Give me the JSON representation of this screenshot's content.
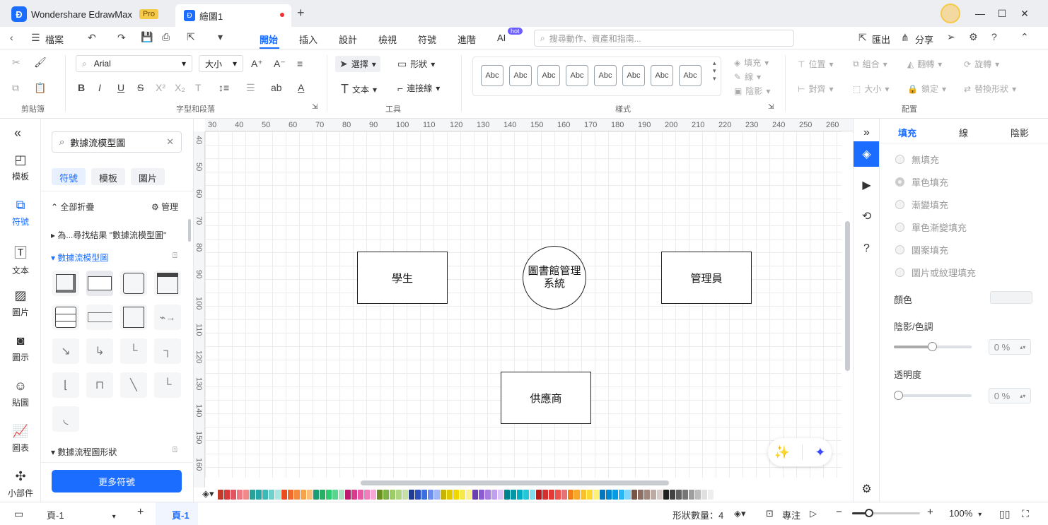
{
  "app": {
    "name": "Wondershare EdrawMax",
    "badge": "Pro",
    "doc_tab": "繪圖1"
  },
  "menu": {
    "back": "檔案",
    "items": [
      "開始",
      "插入",
      "設計",
      "檢視",
      "符號",
      "進階",
      "AI"
    ],
    "hot": "hot",
    "search_placeholder": "搜尋動作、資產和指南...",
    "export": "匯出",
    "share": "分享"
  },
  "ribbon": {
    "font": "Arial",
    "size": "大小",
    "select": "選擇",
    "shape": "形狀",
    "text": "文本",
    "connector": "連接線",
    "style_sample": "Abc",
    "fill": "填充",
    "line": "線",
    "shadow": "陰影",
    "position": "位置",
    "group": "組合",
    "flip": "翻轉",
    "rotate": "旋轉",
    "align": "對齊",
    "lock": "鎖定",
    "replace": "替換形狀",
    "groups": {
      "clipboard": "剪貼簿",
      "font_para": "字型和段落",
      "tools": "工具",
      "styles": "樣式",
      "arrange": "配置"
    }
  },
  "leftnav": [
    "模板",
    "符號",
    "文本",
    "圖片",
    "圖示",
    "貼圖",
    "圖表",
    "小部件"
  ],
  "library": {
    "search": "數據流模型圖",
    "chips": [
      "符號",
      "模板",
      "圖片"
    ],
    "collapse_all": "全部折疊",
    "manage": "管理",
    "result": "為...尋找結果 \"數據流模型圖\"",
    "section1": "數據流模型圖",
    "section2": "數據流程圖形狀",
    "more": "更多符號"
  },
  "rulers": {
    "h": [
      "30",
      "40",
      "50",
      "60",
      "70",
      "80",
      "90",
      "100",
      "110",
      "120",
      "130",
      "140",
      "150",
      "160",
      "170",
      "180",
      "190",
      "200",
      "210",
      "220",
      "230",
      "240",
      "250",
      "260"
    ],
    "v": [
      "40",
      "50",
      "60",
      "70",
      "80",
      "90",
      "100",
      "110",
      "120",
      "130",
      "140",
      "150",
      "160"
    ]
  },
  "diagram": {
    "student": "學生",
    "system_line1": "圖書館管理",
    "system_line2": "系統",
    "admin": "管理員",
    "supplier": "供應商"
  },
  "rightpanel": {
    "tabs": [
      "填充",
      "線",
      "陰影"
    ],
    "options": [
      "無填充",
      "單色填充",
      "漸變填充",
      "單色漸變填充",
      "圖案填充",
      "圖片或紋理填充"
    ],
    "color": "顏色",
    "shade": "陰影/色調",
    "shade_val": "0 %",
    "transparency": "透明度",
    "trans_val": "0 %"
  },
  "status": {
    "page": "頁-1",
    "page_tab": "頁-1",
    "count": "形狀數量：4",
    "focus": "專注",
    "zoom": "100%"
  },
  "palette": [
    "#c0392b",
    "#d63a3a",
    "#e05560",
    "#ef7a85",
    "#f08a8a",
    "#2aa198",
    "#26a6a4",
    "#3cb9b4",
    "#6fcfca",
    "#a8e6e1",
    "#e84d1c",
    "#f06b2b",
    "#f58a3d",
    "#f7a24d",
    "#f9bd7a",
    "#1a9b73",
    "#27ae60",
    "#2ecc71",
    "#58d68d",
    "#a9dfbf",
    "#c0186e",
    "#d83a8c",
    "#e85aa6",
    "#f07fbf",
    "#f5a8d4",
    "#6b8e23",
    "#7cb342",
    "#9ccc65",
    "#aed581",
    "#c5e1a5",
    "#1f3a93",
    "#2c4fbf",
    "#3b6fe0",
    "#6c8ef0",
    "#a0b8f7",
    "#c8b400",
    "#e0c800",
    "#f1d900",
    "#f7e94d",
    "#fbf28f",
    "#6c3fb0",
    "#8a5bd1",
    "#a87ce3",
    "#c29ef0",
    "#dcc4f7",
    "#00838f",
    "#0097a7",
    "#00acc1",
    "#26c6da",
    "#80deea",
    "#b71c1c",
    "#d32f2f",
    "#e53935",
    "#ef5350",
    "#e57373",
    "#f57f17",
    "#f9a825",
    "#fbc02d",
    "#fdd835",
    "#fff176",
    "#0277bd",
    "#0288d1",
    "#039be5",
    "#29b6f6",
    "#81d4fa",
    "#795548",
    "#8d6e63",
    "#a1887f",
    "#bcaaa4",
    "#d7ccc8",
    "#212121",
    "#424242",
    "#616161",
    "#757575",
    "#9e9e9e",
    "#bdbdbd",
    "#e0e0e0",
    "#eeeeee"
  ],
  "colors": {
    "accent": "#1a6dff"
  }
}
